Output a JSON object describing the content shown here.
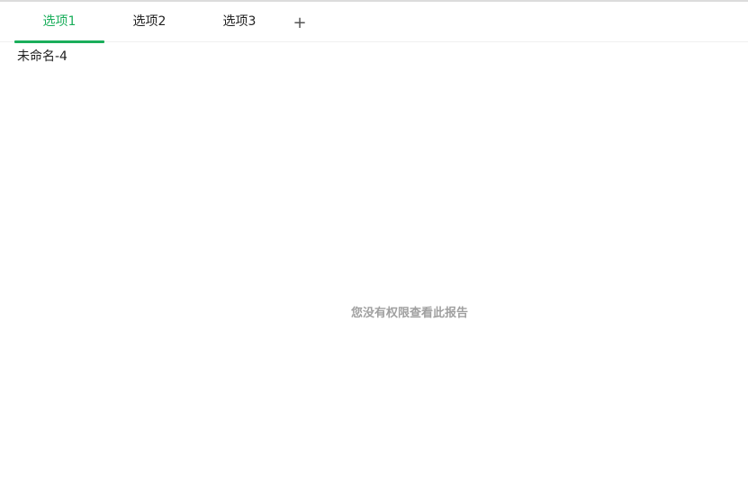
{
  "tabs": [
    {
      "label": "选项1",
      "active": true
    },
    {
      "label": "选项2",
      "active": false
    },
    {
      "label": "选项3",
      "active": false
    }
  ],
  "add_tab": {
    "label": "+"
  },
  "report": {
    "title": "未命名-4"
  },
  "message": "您没有权限查看此报告",
  "colors": {
    "accent": "#1aae5b",
    "muted_text": "#a0a0a0"
  }
}
